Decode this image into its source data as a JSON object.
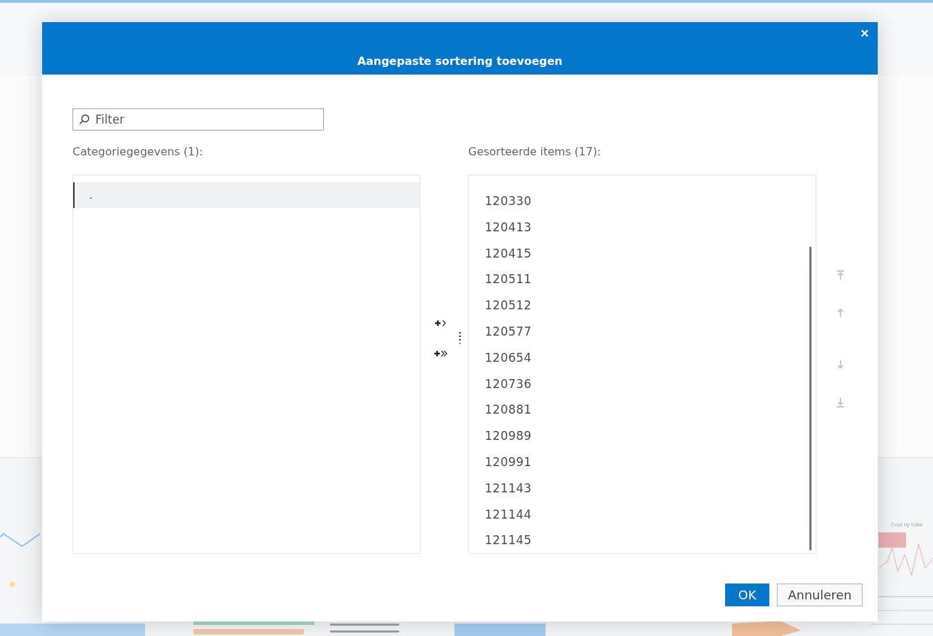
{
  "background": {
    "chart_caption": "Cost by Date"
  },
  "dialog": {
    "title": "Aangepaste sortering toevoegen",
    "close": "×",
    "filter": {
      "placeholder": "Filter"
    },
    "source_label": "Categoriegegevens (1):",
    "source_items": [
      {
        "label": ".",
        "selected": true
      }
    ],
    "target_label": "Gesorteerde items (17):",
    "target_items": [
      {
        "label": "120330",
        "selected": false
      },
      {
        "label": "120413",
        "selected": false
      },
      {
        "label": "120415",
        "selected": false
      },
      {
        "label": "120511",
        "selected": false
      },
      {
        "label": "120512",
        "selected": false
      },
      {
        "label": "120577",
        "selected": false
      },
      {
        "label": "120654",
        "selected": false
      },
      {
        "label": "120736",
        "selected": false
      },
      {
        "label": "120881",
        "selected": false
      },
      {
        "label": "120989",
        "selected": false
      },
      {
        "label": "120991",
        "selected": false
      },
      {
        "label": "121143",
        "selected": false
      },
      {
        "label": "121144",
        "selected": false
      },
      {
        "label": "121145",
        "selected": false
      }
    ],
    "order_buttons": [
      {
        "kind": "top",
        "disabled": true
      },
      {
        "kind": "up",
        "disabled": true
      },
      {
        "kind": "down",
        "disabled": true
      },
      {
        "kind": "bottom",
        "disabled": true
      }
    ],
    "buttons": [
      {
        "label": "OK",
        "kind": "primary"
      },
      {
        "label": "Annuleren",
        "kind": "secondary"
      }
    ]
  }
}
